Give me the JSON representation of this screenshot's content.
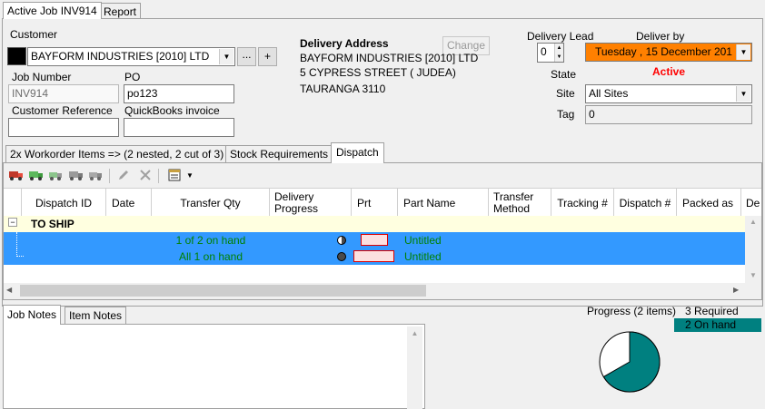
{
  "tabs_top": [
    "Active Job INV914",
    "Report"
  ],
  "customer": {
    "label": "Customer",
    "value": "BAYFORM INDUSTRIES [2010] LTD",
    "ellipsis_btn": "...",
    "add_btn": "+",
    "swatch_color": "#000000"
  },
  "job_number": {
    "label": "Job Number",
    "value": "INV914"
  },
  "po": {
    "label": "PO",
    "value": "po123"
  },
  "customer_reference": {
    "label": "Customer Reference",
    "value": ""
  },
  "quickbooks_invoice": {
    "label": "QuickBooks invoice",
    "value": ""
  },
  "delivery_address": {
    "label": "Delivery Address",
    "change_btn": "Change",
    "line1": "BAYFORM INDUSTRIES [2010] LTD",
    "line2": "5 CYPRESS STREET ( JUDEA)",
    "line3": "TAURANGA  3110"
  },
  "delivery_lead": {
    "label": "Delivery Lead",
    "value": "0"
  },
  "deliver_by": {
    "label": "Deliver by",
    "value": "Tuesday  , 15 December 201",
    "bg": "#ff8000"
  },
  "state": {
    "label": "State",
    "value": "Active",
    "color": "#ff0000"
  },
  "site": {
    "label": "Site",
    "value": "All Sites"
  },
  "tag": {
    "label": "Tag",
    "value": "0"
  },
  "mid_tabs": [
    "2x Workorder Items => (2 nested, 2 cut of 3)",
    "Stock Requirements",
    "Dispatch"
  ],
  "toolbar_icons": [
    "truck-red-icon",
    "truck-green-icon",
    "truck-green-small-icon",
    "truck-grey-icon",
    "truck-grey-small-icon",
    "pencil-icon",
    "delete-x-icon",
    "form-icon",
    "dropdown-arrow-icon"
  ],
  "grid": {
    "columns": [
      "Dispatch ID",
      "Date",
      "Transfer Qty",
      "Delivery Progress",
      "Prt",
      "Part Name",
      "Transfer Method",
      "Tracking #",
      "Dispatch #",
      "Packed as",
      "De"
    ],
    "group_label": "TO SHIP",
    "group_toggle": "−",
    "rows": [
      {
        "qty": "1 of 2 on hand",
        "part_name": "Untitled"
      },
      {
        "qty": "All 1 on hand",
        "part_name": "Untitled"
      }
    ]
  },
  "bottom_tabs": [
    "Job Notes",
    "Item Notes"
  ],
  "progress": {
    "label": "Progress (2 items)",
    "required": "3 Required",
    "on_hand": "2 On hand",
    "on_hand_color": "#008080",
    "fraction": 0.6667
  }
}
